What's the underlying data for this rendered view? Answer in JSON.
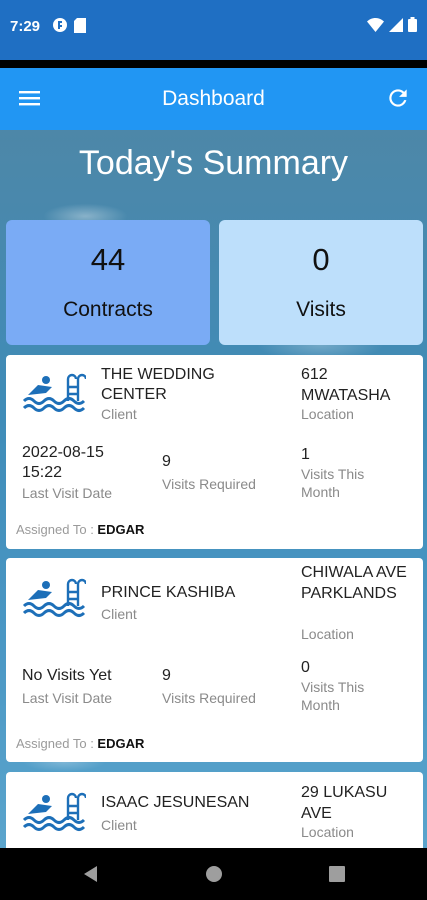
{
  "status_bar": {
    "time": "7:29",
    "left_icons": [
      "app-notification-icon",
      "sd-card-icon"
    ],
    "right_icons": [
      "wifi-icon",
      "cell-signal-icon",
      "battery-icon"
    ]
  },
  "app_bar": {
    "title": "Dashboard",
    "menu_icon": "menu-icon",
    "refresh_icon": "refresh-icon",
    "color": "#2196f3"
  },
  "summary": {
    "title": "Today's Summary",
    "contracts": {
      "value": "44",
      "label": "Contracts",
      "color": "#7aabf5"
    },
    "visits": {
      "value": "0",
      "label": "Visits",
      "color": "#bddffb"
    }
  },
  "cards": [
    {
      "icon": "swimming-pool-icon",
      "client_name": "THE WEDDING CENTER",
      "client_label": "Client",
      "location": "612 MWATASHA",
      "location_label": "Location",
      "last_visit_value": "2022-08-15 15:22",
      "last_visit_label": "Last Visit Date",
      "visits_required_value": "9",
      "visits_required_label": "Visits Required",
      "visits_month_value": "1",
      "visits_month_label": "Visits This Month",
      "assigned_label": "Assigned To : ",
      "assigned_name": "EDGAR"
    },
    {
      "icon": "swimming-pool-icon",
      "client_name": "PRINCE KASHIBA",
      "client_label": "Client",
      "location": "CHIWALA AVE PARKLANDS",
      "location_label": "Location",
      "last_visit_value": "No Visits Yet",
      "last_visit_label": "Last Visit Date",
      "visits_required_value": "9",
      "visits_required_label": "Visits Required",
      "visits_month_value": "0",
      "visits_month_label": "Visits This Month",
      "assigned_label": "Assigned To : ",
      "assigned_name": "EDGAR"
    },
    {
      "icon": "swimming-pool-icon",
      "client_name": "ISAAC JESUNESAN",
      "client_label": "Client",
      "location": "29 LUKASU AVE",
      "location_label": "Location"
    }
  ],
  "nav_bar": {
    "icons": [
      "back-icon",
      "home-icon",
      "recents-icon"
    ]
  }
}
